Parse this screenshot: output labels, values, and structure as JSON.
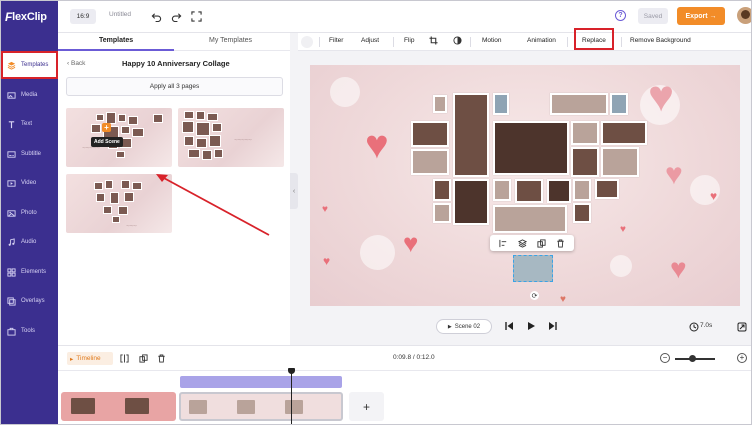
{
  "app": {
    "logo_text": "lexClip",
    "logo_letter": "F"
  },
  "colors": {
    "sidebar": "#3b2f8f",
    "accent": "#6b5bd6",
    "export": "#f28c28",
    "annotation": "#d8222a"
  },
  "sidebar": {
    "items": [
      {
        "label": "Templates",
        "icon": "templates-icon"
      },
      {
        "label": "Media",
        "icon": "media-icon"
      },
      {
        "label": "Text",
        "icon": "text-icon"
      },
      {
        "label": "Subtitle",
        "icon": "subtitle-icon"
      },
      {
        "label": "Video",
        "icon": "video-icon"
      },
      {
        "label": "Photo",
        "icon": "photo-icon"
      },
      {
        "label": "Audio",
        "icon": "audio-icon"
      },
      {
        "label": "Elements",
        "icon": "elements-icon"
      },
      {
        "label": "Overlays",
        "icon": "overlays-icon"
      },
      {
        "label": "Tools",
        "icon": "tools-icon"
      }
    ]
  },
  "topbar": {
    "ratio": "16:9",
    "title": "Untitled",
    "help": "?",
    "saved": "Saved",
    "export": "Export →"
  },
  "panel": {
    "tabs": [
      "Templates",
      "My Templates"
    ],
    "back": "Back",
    "title": "Happy 10 Anniversary Collage",
    "apply": "Apply all 3 pages",
    "tooltip": "Add Scene",
    "plus": "+"
  },
  "toolbar": {
    "items": [
      "Filter",
      "Adjust",
      "Flip",
      "Motion",
      "Animation",
      "Replace",
      "Remove Background"
    ]
  },
  "playback": {
    "scene": "Scene 02",
    "duration": "7.0s"
  },
  "timeline": {
    "label": "Timeline",
    "timecode": "0:09.8 / 0:12.0",
    "zoom_out": "−",
    "zoom_in": "+",
    "add": "+"
  }
}
